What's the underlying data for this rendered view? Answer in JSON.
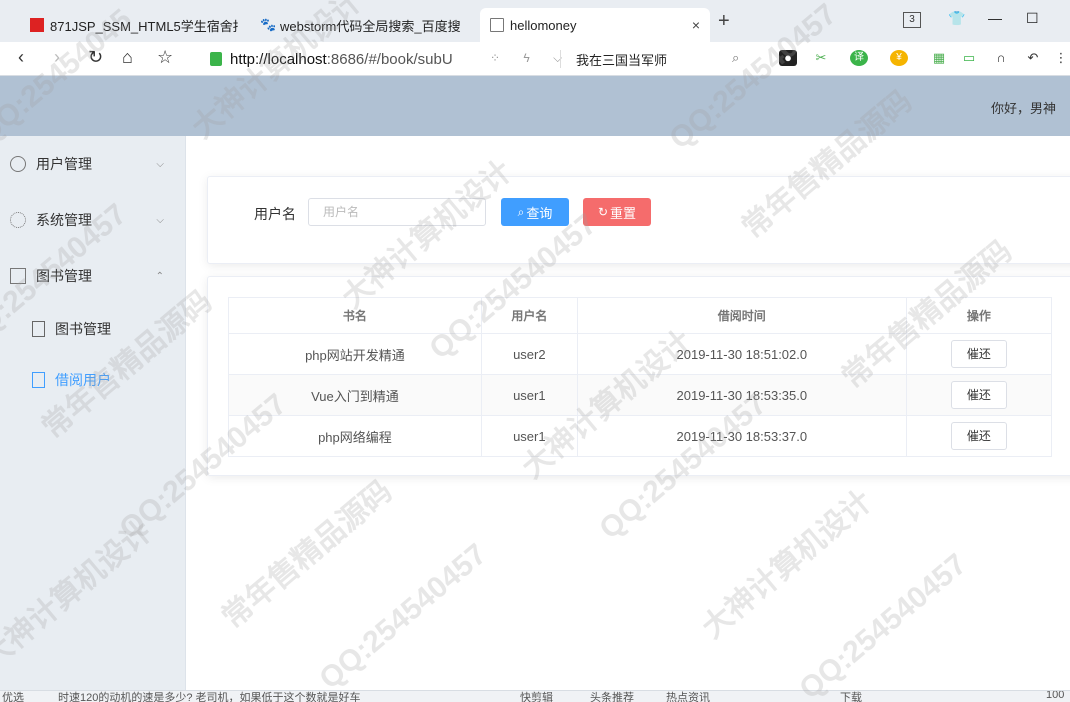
{
  "browser": {
    "tabs": [
      {
        "title": "871JSP_SSM_HTML5学生宿舍报",
        "icon": "red-square-icon"
      },
      {
        "title": "webstorm代码全局搜索_百度搜",
        "icon": "baidu-paw-icon"
      },
      {
        "title": "hellomoney",
        "icon": "document-icon",
        "close": "×"
      }
    ],
    "new_tab": "+",
    "tab_count": "3",
    "url": {
      "host": "http://localhost",
      "rest": ":8686/#/book/subU"
    },
    "search_text": "我在三国当军师"
  },
  "header": {
    "greeting": "你好，男神"
  },
  "sidebar": {
    "items": [
      {
        "label": "用户管理",
        "icon": "user-icon",
        "arrow": "⌵"
      },
      {
        "label": "系统管理",
        "icon": "gear-icon",
        "arrow": "⌵"
      },
      {
        "label": "图书管理",
        "icon": "book-icon",
        "arrow": "⌃"
      }
    ],
    "sub_items": [
      {
        "label": "图书管理",
        "icon": "list-icon"
      },
      {
        "label": "借阅用户",
        "icon": "list-icon",
        "active": true
      }
    ]
  },
  "search": {
    "label": "用户名",
    "placeholder": "用户名",
    "query_label": "查询",
    "reset_label": "重置"
  },
  "table": {
    "headers": [
      "书名",
      "用户名",
      "借阅时间",
      "操作"
    ],
    "rows": [
      {
        "book": "php网站开发精通",
        "user": "user2",
        "time": "2019-11-30 18:51:02.0",
        "action": "催还"
      },
      {
        "book": "Vue入门到精通",
        "user": "user1",
        "time": "2019-11-30 18:53:35.0",
        "action": "催还"
      },
      {
        "book": "php网络编程",
        "user": "user1",
        "time": "2019-11-30 18:53:37.0",
        "action": "催还"
      }
    ]
  },
  "statusbar": {
    "left": "优选",
    "news": "时速120的动机的速是多少? 老司机，如果低于这个数就是好车",
    "items": [
      "快剪辑",
      "头条推荐",
      "热点资讯",
      "下载",
      "100"
    ]
  },
  "watermark": {
    "lines": [
      "QQ:25454045",
      "大神计算机设计",
      "常年售精品源码",
      "QQ:254540457"
    ]
  },
  "colors": {
    "primary": "#409eff",
    "danger": "#f56c6c",
    "header_bg": "#b0c1d3",
    "sidebar_bg": "#e8edf2"
  }
}
